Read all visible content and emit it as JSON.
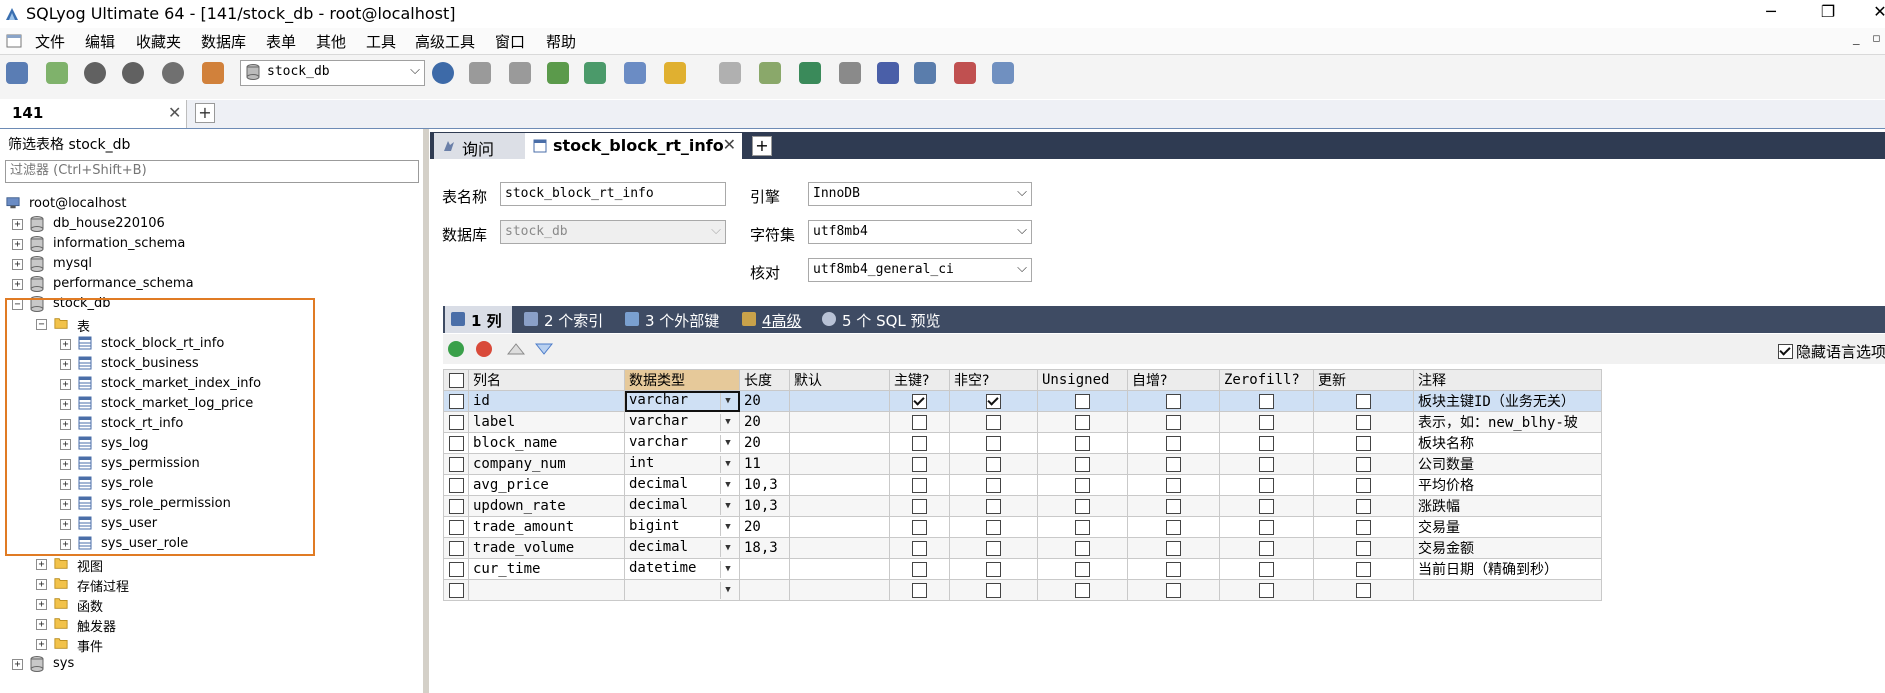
{
  "window": {
    "title": "SQLyog Ultimate 64 - [141/stock_db - root@localhost]",
    "controls": {
      "minimize": "─",
      "restore": "❐",
      "close": "✕"
    }
  },
  "menu": [
    "文件",
    "编辑",
    "收藏夹",
    "数据库",
    "表单",
    "其他",
    "工具",
    "高级工具",
    "窗口",
    "帮助"
  ],
  "mdi_controls": [
    "_",
    "▫"
  ],
  "toolbar": {
    "db_select": "stock_db",
    "icons": [
      "new-connection-icon",
      "new-query-icon",
      "execute-icon",
      "execute-all-icon",
      "stop-icon",
      "refresh-icon",
      "db-icon",
      "table-add-icon",
      "import-icon",
      "export-icon",
      "grid-icon",
      "table-icon",
      "schema-icon",
      "history-icon",
      "backup-icon",
      "sync-icon",
      "copy-db-icon",
      "query-builder-icon",
      "scheduler-icon",
      "profile-icon",
      "designer-icon"
    ]
  },
  "connection_tab": {
    "label": "141",
    "close": "✕",
    "add": "+"
  },
  "left": {
    "filter_label": "筛选表格 stock_db",
    "filter_placeholder": "过滤器 (Ctrl+Shift+B)",
    "tree": {
      "root": "root@localhost",
      "databases": [
        "db_house220106",
        "information_schema",
        "mysql",
        "performance_schema"
      ],
      "active_db": "stock_db",
      "tables_folder": "表",
      "tables": [
        "stock_block_rt_info",
        "stock_business",
        "stock_market_index_info",
        "stock_market_log_price",
        "stock_rt_info",
        "sys_log",
        "sys_permission",
        "sys_role",
        "sys_role_permission",
        "sys_user",
        "sys_user_role"
      ],
      "other_folders": [
        "视图",
        "存储过程",
        "函数",
        "触发器",
        "事件"
      ],
      "last_db": "sys"
    }
  },
  "query_tabs": {
    "query": "询问",
    "table": "stock_block_rt_info",
    "add": "+"
  },
  "form": {
    "table_name_label": "表名称",
    "table_name": "stock_block_rt_info",
    "database_label": "数据库",
    "database": "stock_db",
    "engine_label": "引擎",
    "engine": "InnoDB",
    "charset_label": "字符集",
    "charset": "utf8mb4",
    "collation_label": "核对",
    "collation": "utf8mb4_general_ci"
  },
  "sub_tabs": [
    "1 列",
    "2 个索引",
    "3 个外部键",
    "4高级",
    "5 个 SQL 预览"
  ],
  "hide_language_option": "隐藏语言选项",
  "grid": {
    "headers": [
      "列名",
      "数据类型",
      "长度",
      "默认",
      "主键?",
      "非空?",
      "Unsigned",
      "自增?",
      "Zerofill?",
      "更新",
      "注释"
    ],
    "rows": [
      {
        "name": "id",
        "type": "varchar",
        "len": "20",
        "pk": true,
        "nn": true,
        "comment": "板块主键ID（业务无关）"
      },
      {
        "name": "label",
        "type": "varchar",
        "len": "20",
        "pk": false,
        "nn": false,
        "comment": "表示，如：new_blhy-玻"
      },
      {
        "name": "block_name",
        "type": "varchar",
        "len": "20",
        "pk": false,
        "nn": false,
        "comment": "板块名称"
      },
      {
        "name": "company_num",
        "type": "int",
        "len": "11",
        "pk": false,
        "nn": false,
        "comment": "公司数量"
      },
      {
        "name": "avg_price",
        "type": "decimal",
        "len": "10,3",
        "pk": false,
        "nn": false,
        "comment": "平均价格"
      },
      {
        "name": "updown_rate",
        "type": "decimal",
        "len": "10,3",
        "pk": false,
        "nn": false,
        "comment": "涨跌幅"
      },
      {
        "name": "trade_amount",
        "type": "bigint",
        "len": "20",
        "pk": false,
        "nn": false,
        "comment": "交易量"
      },
      {
        "name": "trade_volume",
        "type": "decimal",
        "len": "18,3",
        "pk": false,
        "nn": false,
        "comment": "交易金额"
      },
      {
        "name": "cur_time",
        "type": "datetime",
        "len": "",
        "pk": false,
        "nn": false,
        "comment": "当前日期（精确到秒）"
      },
      {
        "name": "",
        "type": "",
        "len": "",
        "pk": false,
        "nn": false,
        "comment": ""
      }
    ]
  },
  "colors": {
    "tab_dark": "#2f3b52",
    "subtab_dark": "#3e4b63",
    "highlight": "#e07b24",
    "selected_row": "#cfe0f4"
  }
}
